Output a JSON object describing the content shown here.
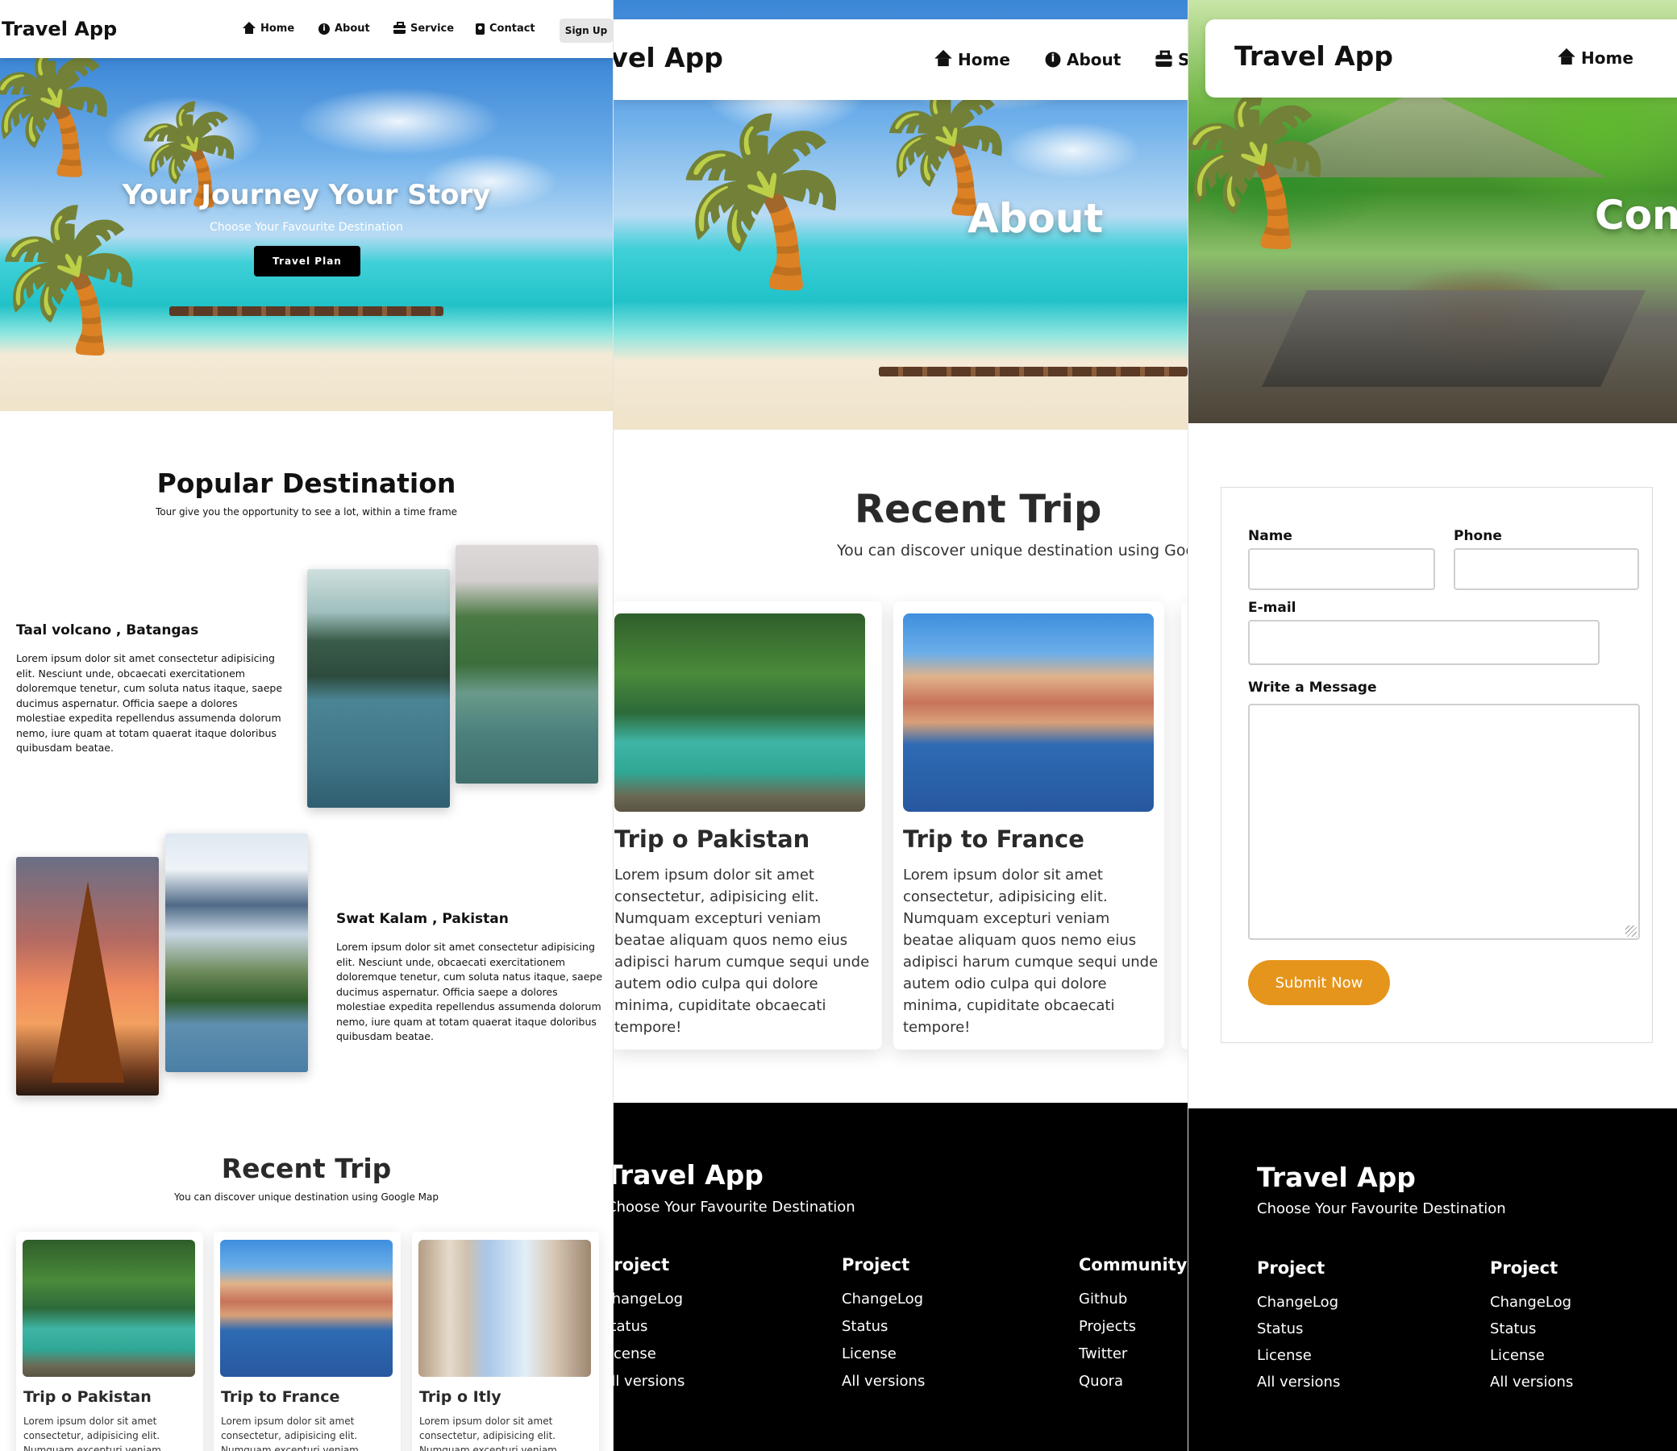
{
  "brand": "Travel App",
  "tagline": "Choose Your Favourite Destination",
  "nav": {
    "home": "Home",
    "about": "About",
    "service": "Service",
    "contact": "Contact",
    "signup": "Sign Up"
  },
  "home_page": {
    "hero_title": "Your Journey Your Story",
    "hero_subtitle": "Choose Your Favourite Destination",
    "hero_button": "Travel Plan",
    "popular_title": "Popular Destination",
    "popular_subtitle": "Tour give you the opportunity to see a lot, within a time frame",
    "destinations": [
      {
        "name": "Taal volcano , Batangas",
        "description": "Lorem ipsum dolor sit amet consectetur adipisicing elit. Nesciunt unde, obcaecati exercitationem doloremque tenetur, cum soluta natus itaque, saepe ducimus aspernatur. Officia saepe a dolores molestiae expedita repellendus assumenda dolorum nemo, iure quam at totam quaerat itaque doloribus quibusdam beatae."
      },
      {
        "name": "Swat Kalam , Pakistan",
        "description": "Lorem ipsum dolor sit amet consectetur adipisicing elit. Nesciunt unde, obcaecati exercitationem doloremque tenetur, cum soluta natus itaque, saepe ducimus aspernatur. Officia saepe a dolores molestiae expedita repellendus assumenda dolorum nemo, iure quam at totam quaerat itaque doloribus quibusdam beatae."
      }
    ],
    "recent_title": "Recent Trip",
    "recent_subtitle": "You can discover unique destination using Google Map",
    "trips": [
      {
        "title": "Trip o Pakistan",
        "text": "Lorem ipsum dolor sit amet consectetur, adipisicing elit. Numquam excepturi veniam"
      },
      {
        "title": "Trip to France",
        "text": "Lorem ipsum dolor sit amet consectetur, adipisicing elit. Numquam excepturi veniam"
      },
      {
        "title": "Trip o Itly",
        "text": "Lorem ipsum dolor sit amet consectetur, adipisicing elit. Numquam excepturi veniam"
      }
    ]
  },
  "about_page": {
    "hero_title": "About",
    "recent_title": "Recent Trip",
    "recent_subtitle": "You can discover unique destination using Google",
    "trips": [
      {
        "title": "Trip o Pakistan",
        "text": "Lorem ipsum dolor sit amet consectetur, adipisicing elit. Numquam excepturi veniam beatae aliquam quos nemo eius adipisci harum cumque sequi unde autem odio culpa qui dolore minima, cupiditate obcaecati tempore!"
      },
      {
        "title": "Trip to France",
        "text": "Lorem ipsum dolor sit amet consectetur, adipisicing elit. Numquam excepturi veniam beatae aliquam quos nemo eius adipisci harum cumque sequi unde autem odio culpa qui dolore minima, cupiditate obcaecati tempore!"
      }
    ]
  },
  "contact_page": {
    "hero_title": "Con",
    "form": {
      "name_label": "Name",
      "phone_label": "Phone",
      "email_label": "E-mail",
      "message_label": "Write a Message",
      "name_value": "",
      "phone_value": "",
      "email_value": "",
      "message_value": "",
      "submit_label": "Submit Now"
    }
  },
  "footer": {
    "brand": "Travel App",
    "tagline": "Choose Your Favourite Destination",
    "columns": [
      {
        "heading": "Project",
        "links": [
          "ChangeLog",
          "Status",
          "License",
          "All versions"
        ]
      },
      {
        "heading": "Project",
        "links": [
          "ChangeLog",
          "Status",
          "License",
          "All versions"
        ]
      },
      {
        "heading": "Community",
        "links": [
          "Github",
          "Projects",
          "Twitter",
          "Quora"
        ]
      }
    ]
  },
  "colors": {
    "accent": "#e6951c",
    "footer_bg": "#000000",
    "button_dark": "#000000"
  }
}
